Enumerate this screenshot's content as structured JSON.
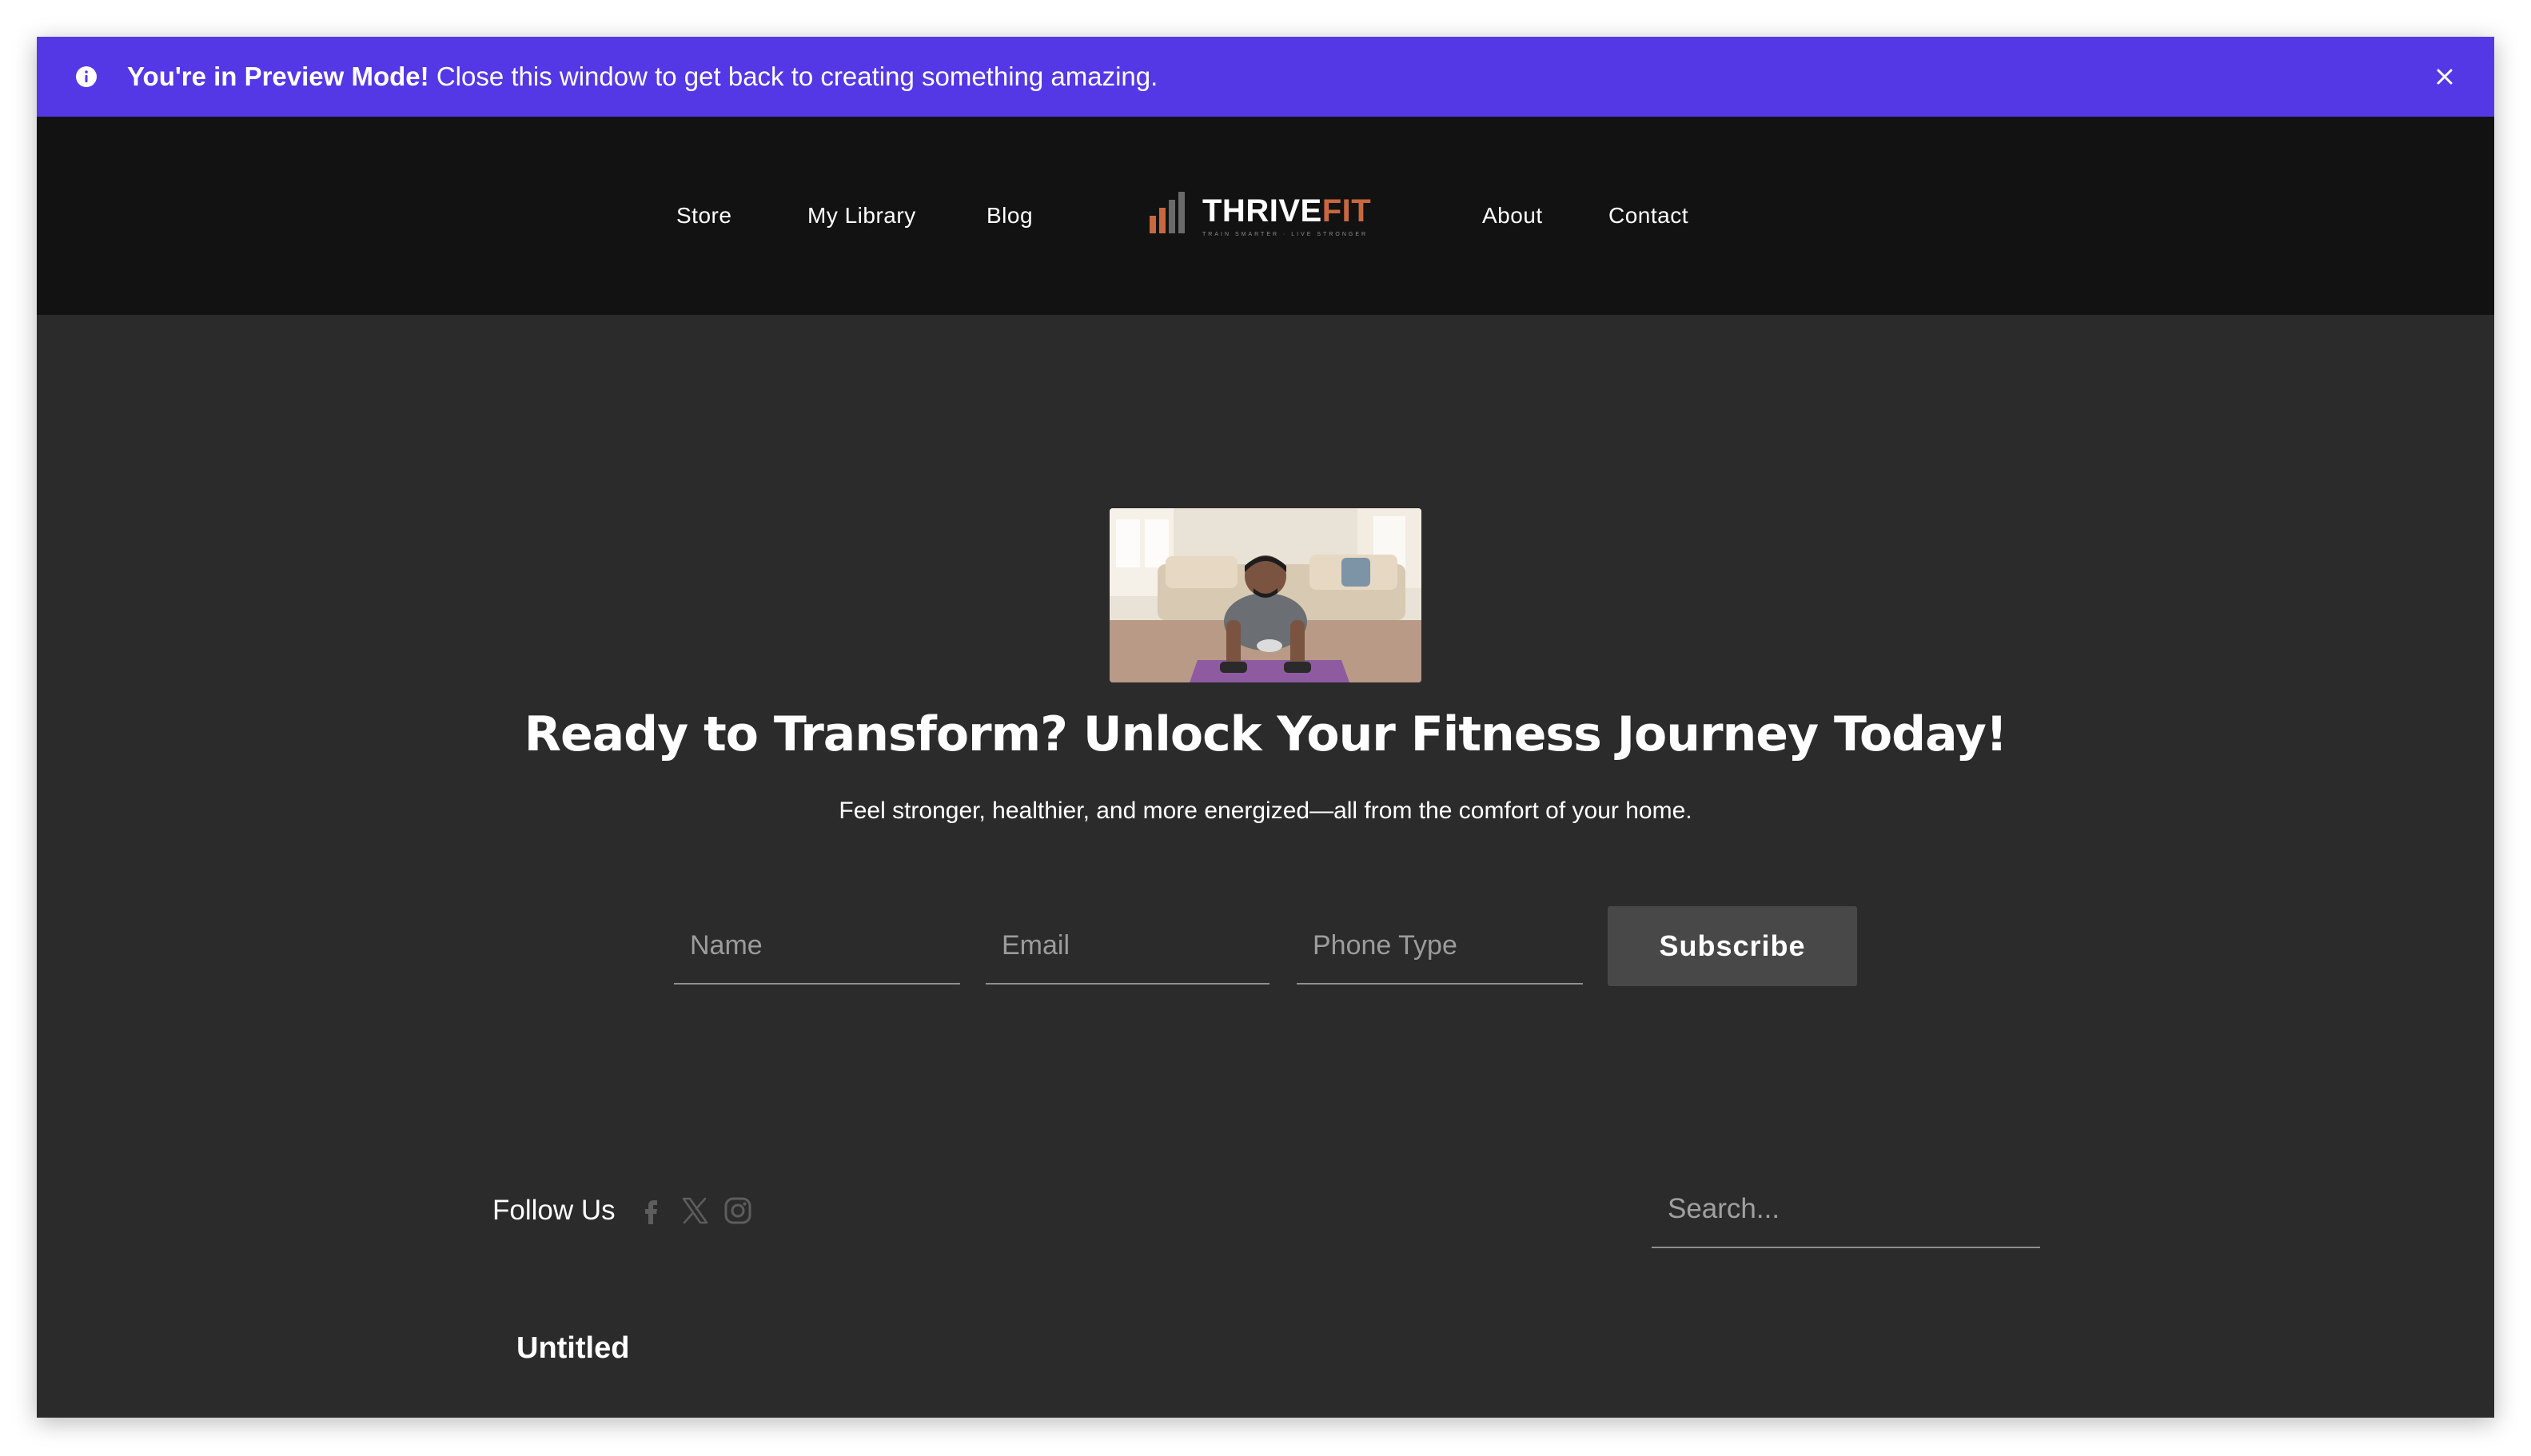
{
  "preview_bar": {
    "bold_text": "You're in Preview Mode!",
    "text": " Close this window to get back to creating something amazing.",
    "icon": "info-icon",
    "close_icon": "close-icon",
    "background": "#5438e6"
  },
  "nav": {
    "left_items": [
      {
        "label": "Store"
      },
      {
        "label": "My Library"
      },
      {
        "label": "Blog"
      }
    ],
    "right_items": [
      {
        "label": "About"
      },
      {
        "label": "Contact"
      }
    ],
    "logo": {
      "word_main": "THRIVE",
      "word_accent": "FIT",
      "tagline": "TRAIN SMARTER · LIVE STRONGER",
      "accent_color": "#c8683e"
    }
  },
  "hero": {
    "image_alt": "Man doing push-ups on a yoga mat in a living room",
    "title": "Ready to Transform? Unlock Your Fitness Journey Today!",
    "subtitle": "Feel stronger, healthier, and more energized—all from the comfort of your home."
  },
  "form": {
    "name_placeholder": "Name",
    "email_placeholder": "Email",
    "phone_placeholder": "Phone Type",
    "submit_label": "Subscribe"
  },
  "footer": {
    "follow_label": "Follow Us",
    "social": [
      "facebook-icon",
      "x-icon",
      "instagram-icon"
    ],
    "search_placeholder": "Search...",
    "untitled": "Untitled"
  }
}
